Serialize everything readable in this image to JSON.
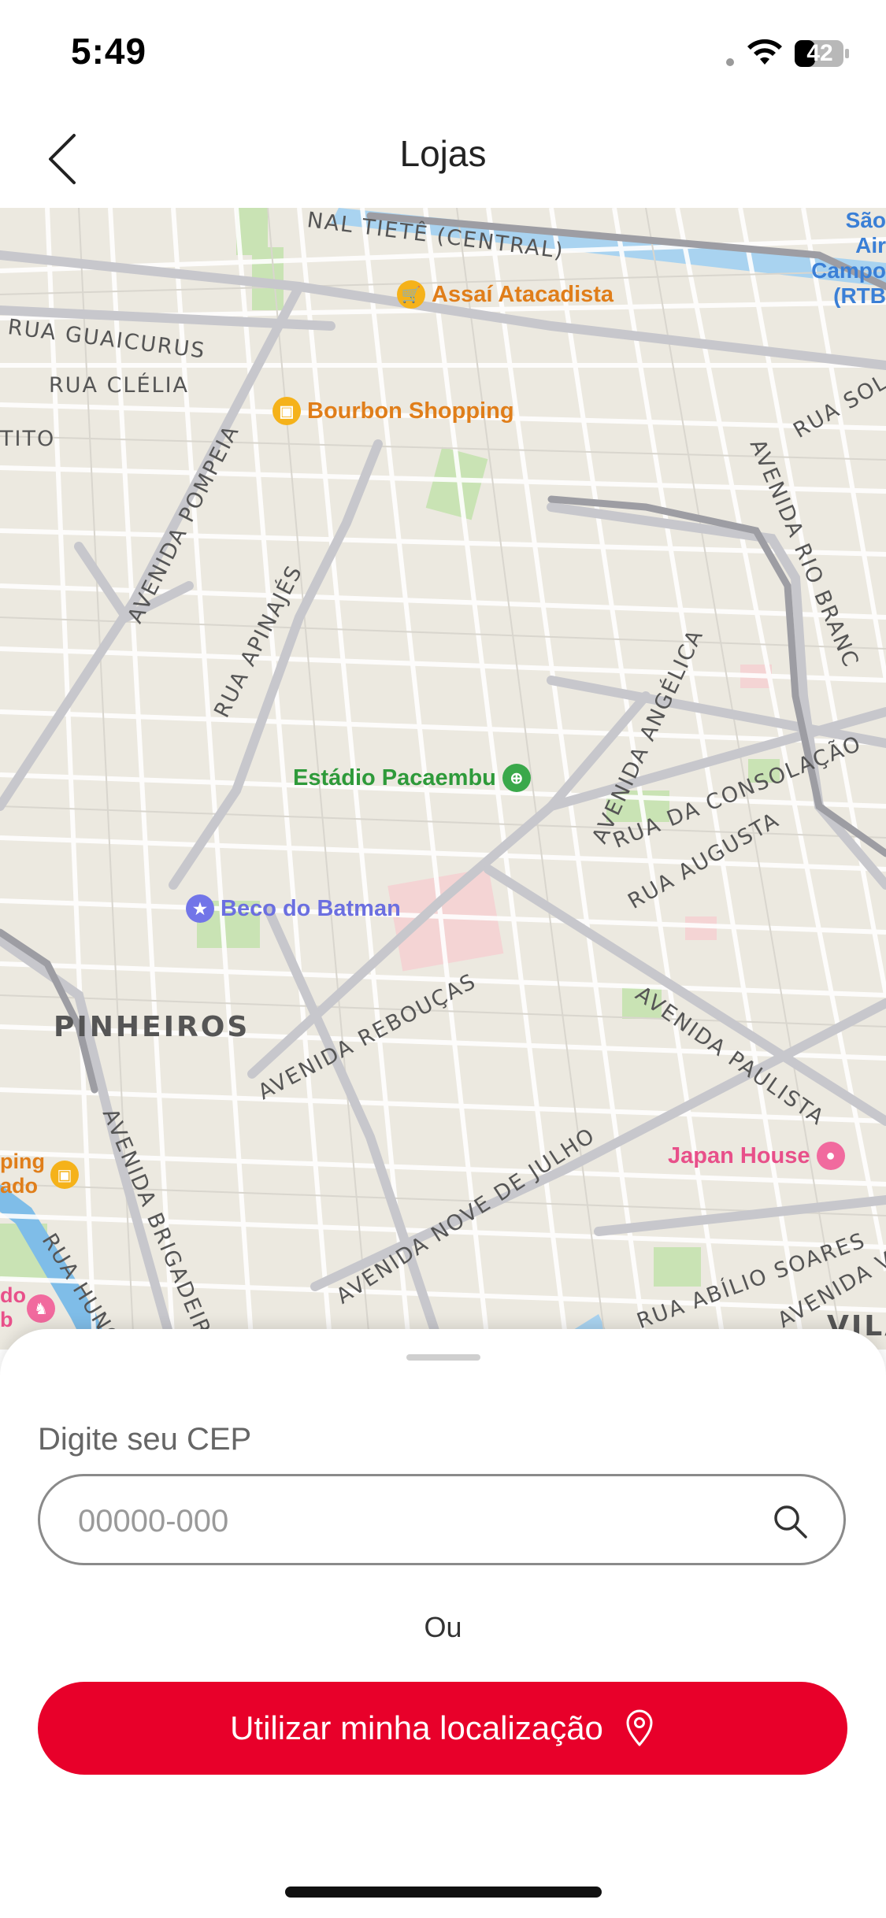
{
  "status_bar": {
    "time": "5:49",
    "battery": "42"
  },
  "header": {
    "title": "Lojas"
  },
  "map": {
    "streets": [
      "NAL TIETÊ (CENTRAL)",
      "RUA GUAICURUS",
      "RUA CLÉLIA",
      "TITO",
      "AVENIDA POMPEIA",
      "RUA APINAJÉS",
      "AVENIDA ANGÉLICA",
      "RUA DA CONSOLAÇÃO",
      "RUA AUGUSTA",
      "AVENIDA REBOUÇAS",
      "AVENIDA PAULISTA",
      "AVENIDA BRIGADEIRO FA",
      "AVENIDA NOVE DE JULHO",
      "RUA ABÍLIO SOARES",
      "AVENIDA VIN",
      "RUA HUNG",
      "RUA SOL",
      "AVENIDA RIO BRANC"
    ],
    "districts": [
      "PINHEIROS",
      "VILA"
    ],
    "pois": [
      {
        "name": "Assaí Atacadista",
        "color": "#e07e1a"
      },
      {
        "name": "Bourbon Shopping",
        "color": "#e07e1a"
      },
      {
        "name": "Estádio Pacaembu",
        "color": "#2e9a3a"
      },
      {
        "name": "Beco do Batman",
        "color": "#6b6fe0"
      },
      {
        "name": "Japan House",
        "color": "#e8508a"
      },
      {
        "name": "ping",
        "color": "#e07e1a"
      },
      {
        "name": "ado",
        "color": "#e07e1a"
      },
      {
        "name": "do",
        "color": "#e8508a"
      },
      {
        "name": "b",
        "color": "#e8508a"
      }
    ],
    "corner_labels": [
      "São",
      "Air",
      "Campo",
      "(RTB"
    ]
  },
  "sheet": {
    "cep_label": "Digite seu CEP",
    "cep_placeholder": "00000-000",
    "cep_value": "",
    "or_text": "Ou",
    "location_button_label": "Utilizar minha localização"
  },
  "colors": {
    "accent": "#e8002a",
    "map_background": "#ece9e0"
  }
}
